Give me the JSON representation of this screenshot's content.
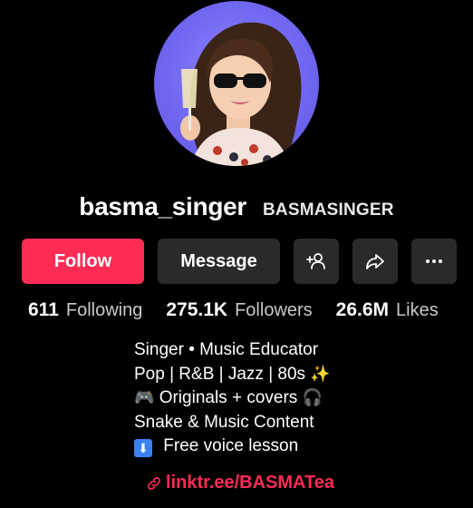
{
  "profile": {
    "username": "basma_singer",
    "nickname": "BASMASINGER",
    "avatar_icon": "profile-avatar"
  },
  "actions": {
    "follow_label": "Follow",
    "message_label": "Message",
    "add_user_icon": "add-user-icon",
    "share_icon": "share-icon",
    "more_icon": "more-icon"
  },
  "stats": [
    {
      "value": "611",
      "label": "Following"
    },
    {
      "value": "275.1K",
      "label": "Followers"
    },
    {
      "value": "26.6M",
      "label": "Likes"
    }
  ],
  "bio": {
    "line1": "Singer • Music Educator",
    "line2": "Pop | R&B | Jazz | 80s",
    "line2_emoji": "✨",
    "line3_emoji": "🎮",
    "line3": "Originals + covers",
    "line3_emoji_end": "🎧",
    "line4": "Snake & Music Content",
    "line5_emoji": "⬇",
    "line5": "Free voice lesson"
  },
  "link": {
    "text": "linktr.ee/BASMATea",
    "icon": "link-icon"
  },
  "colors": {
    "accent": "#fe2c55",
    "button_bg": "#2a2a2a",
    "background": "#000000"
  }
}
